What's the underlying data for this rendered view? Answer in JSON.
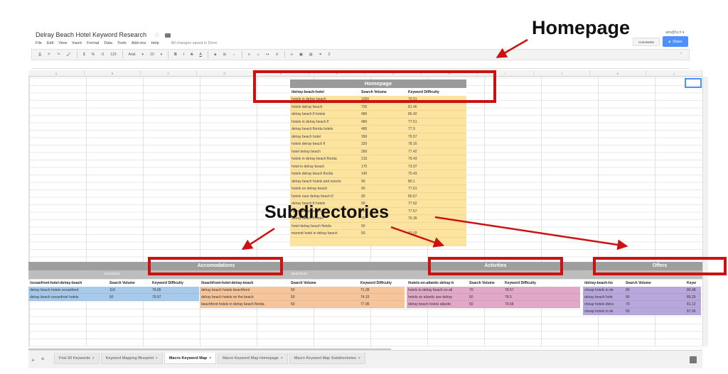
{
  "header": {
    "title": "Delray Beach Hotel Keyword Research",
    "menu": [
      "File",
      "Edit",
      "View",
      "Insert",
      "Format",
      "Data",
      "Tools",
      "Add-ons",
      "Help"
    ],
    "saved_status": "All changes saved in Drive",
    "user": "aim@hs.h",
    "comments_label": "Comments",
    "share_label": "Share"
  },
  "toolbar": {
    "zoom": "123",
    "font": "Arial",
    "font_size": "10"
  },
  "column_letters": [
    "A",
    "B",
    "C",
    "D",
    "E",
    "F",
    "G",
    "H",
    "I",
    "J",
    "K",
    "L"
  ],
  "homepage_table": {
    "title": "Homepage",
    "headers": [
      "/delray-beach-hotel",
      "Search Volume",
      "Keyword Difficulty"
    ],
    "rows": [
      [
        "hotels in delray beach",
        "1000",
        "79.01"
      ],
      [
        "hotels delray beach",
        "720",
        "81.46"
      ],
      [
        "delray beach fl hotels",
        "480",
        "85.42"
      ],
      [
        "hotels in delray beach fl",
        "480",
        "77.51"
      ],
      [
        "delray beach florida hotels",
        "480",
        "77.9"
      ],
      [
        "delray beach hotel",
        "390",
        "76.57"
      ],
      [
        "hotels delray beach fl",
        "320",
        "78.16"
      ],
      [
        "hotel delray beach",
        "260",
        "77.42"
      ],
      [
        "hotels in delray beach florida",
        "210",
        "79.43"
      ],
      [
        "hotel in delray beach",
        "170",
        "73.97"
      ],
      [
        "hotels delray beach florida",
        "140",
        "75.43"
      ],
      [
        "delray beach hotels and resorts",
        "90",
        "80.1"
      ],
      [
        "hotels on delray beach",
        "90",
        "77.61"
      ],
      [
        "hotels near delray beach fl",
        "90",
        "80.67"
      ],
      [
        "delray beach fl hotels",
        "90",
        "77.62"
      ],
      [
        "hotel delray beach fl",
        "70",
        "77.57"
      ],
      [
        "delray beach fl hotel",
        "70",
        "75.39"
      ],
      [
        "hotel delray beach florida",
        "50",
        ""
      ],
      [
        "marriott hotel in delray beach",
        "50",
        "83.03"
      ]
    ]
  },
  "subdirectories": {
    "band_labels": {
      "accomodations": "Accomodations",
      "activities": "Activities",
      "offers": "Offers"
    },
    "sublabels": {
      "oceanfront": "Oceanfront",
      "beachfront": "Beachfront"
    },
    "oceanfront": {
      "headers": [
        "/oceanfront-hotel-delray-beach",
        "Search Volume",
        "Keyword Difficulty"
      ],
      "rows": [
        [
          "delray beach hotels oceanfront",
          "110",
          "79.65"
        ],
        [
          "delray beach oceanfront hotels",
          "50",
          "79.97"
        ]
      ]
    },
    "beachfront": {
      "headers": [
        "/beachfront-hotel-delray-beach",
        "Search Volume",
        "Keyword Difficulty"
      ],
      "rows": [
        [
          "delray beach hotels beachfront",
          "50",
          "71.39"
        ],
        [
          "delray beach hotels on the beach",
          "50",
          "74.15"
        ],
        [
          "beachfront hotels in delray beach florida",
          "50",
          "77.95"
        ]
      ]
    },
    "activities": {
      "headers": [
        "/hotels-on-atlantic-delray-b",
        "Search Volume",
        "Keyword Difficulty"
      ],
      "rows": [
        [
          "hotels in delray beach on atl",
          "70",
          "78.57"
        ],
        [
          "hotels on atlantic ave delray",
          "50",
          "78.5"
        ],
        [
          "delray beach hotels atlantic",
          "50",
          "79.68"
        ]
      ]
    },
    "offers": {
      "headers": [
        "/delray-beach-ho",
        "Search Volume",
        "Keyw"
      ],
      "rows": [
        [
          "cheap hotels in de",
          "90",
          "80.48"
        ],
        [
          "delray beach hote",
          "90",
          "85.29"
        ],
        [
          "cheap hotels delra",
          "70",
          "81.12"
        ],
        [
          "cheap hotels in de",
          "50",
          "87.06"
        ]
      ]
    }
  },
  "annotations": {
    "homepage": "Homepage",
    "subdirectories": "Subdirectories"
  },
  "tabs": [
    {
      "label": "First 50 Keywords",
      "active": false
    },
    {
      "label": "Keyword Mapping Blueprint",
      "active": false
    },
    {
      "label": "Macro Keyword Map",
      "active": true
    },
    {
      "label": "Macro Keyword Map Homepage",
      "active": false
    },
    {
      "label": "Macro Keyword Map Subdirectories",
      "active": false
    }
  ],
  "colors": {
    "callout_red": "#cc1111",
    "homepage_fill": "#fde3a0",
    "oceanfront_fill": "#a7c9ea",
    "beachfront_fill": "#f6c59b",
    "activities_fill": "#e2a8c7",
    "offers_fill": "#b7a7db",
    "share_blue": "#4d90fe"
  }
}
